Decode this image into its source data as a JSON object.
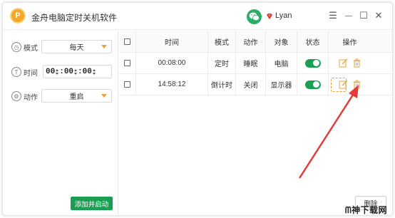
{
  "app": {
    "title": "金舟电脑定时关机软件",
    "logo_letter": "P",
    "username": "Lyan"
  },
  "window_controls": {
    "menu": "☰",
    "minimize": "—",
    "maximize": "☐",
    "close": "✕"
  },
  "form": {
    "mode": {
      "label": "模式",
      "value": "每天"
    },
    "time": {
      "label": "时间",
      "hour": "00",
      "minute": "00",
      "second": "00"
    },
    "action": {
      "label": "动作",
      "value": "重启"
    },
    "add_button": "添加并启动"
  },
  "table": {
    "columns": [
      "时间",
      "模式",
      "动作",
      "对象",
      "状态",
      "操作"
    ],
    "rows": [
      {
        "time": "00:08:00",
        "mode": "定时",
        "action": "睡眠",
        "target": "电脑",
        "enabled": true
      },
      {
        "time": "14:58:12",
        "mode": "倒计时",
        "action": "关闭",
        "target": "显示器",
        "enabled": true
      }
    ],
    "delete_button": "删除"
  },
  "watermark": "ᗰ神下载网",
  "colors": {
    "accent_orange": "#e8a33a",
    "toggle_green": "#1a9f52",
    "add_button_green": "#1a9f52",
    "arrow_red": "#e53a3a"
  }
}
